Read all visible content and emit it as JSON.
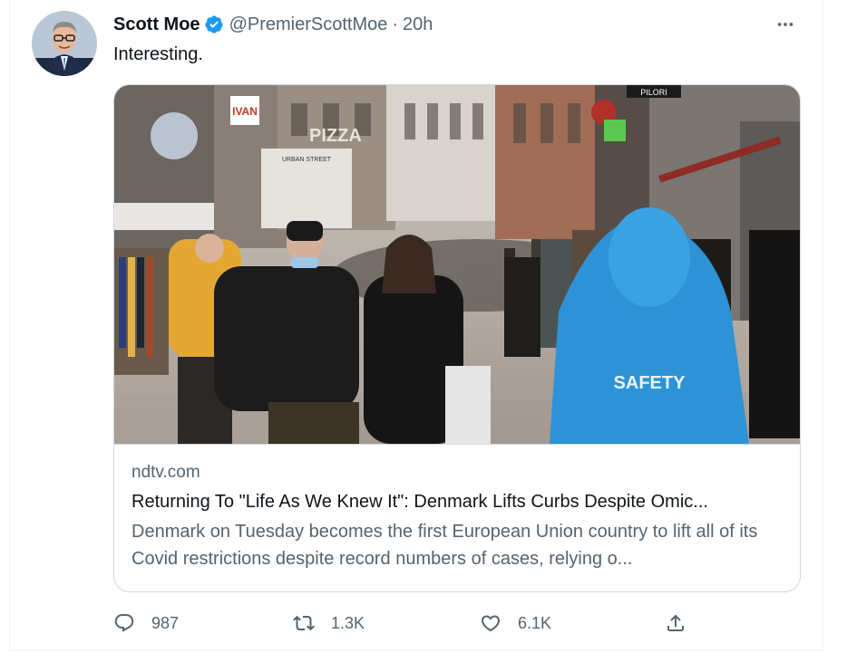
{
  "tweet": {
    "author_name": "Scott Moe",
    "handle": "@PremierScottMoe",
    "separator": "·",
    "time": "20h",
    "text": "Interesting.",
    "verified": true
  },
  "card": {
    "domain": "ndtv.com",
    "title": "Returning To \"Life As We Knew It\": Denmark Lifts Curbs Despite Omic...",
    "description": "Denmark on Tuesday becomes the first European Union country to lift all of its Covid restrictions despite record numbers of cases, relying o...",
    "image_signs": {
      "ivan": "IVAN",
      "pizza": "PIZZA",
      "sign": "URBAN STREET",
      "jacket": "SAFETY",
      "pilori": "PILORI"
    }
  },
  "actions": {
    "reply_count": "987",
    "retweet_count": "1.3K",
    "like_count": "6.1K"
  },
  "colors": {
    "verified_blue": "#1d9bf0",
    "secondary_text": "#536471",
    "primary_text": "#0f1419",
    "border": "#cfd9de"
  },
  "icons": {
    "more": "more-horizontal-icon",
    "reply": "reply-icon",
    "retweet": "retweet-icon",
    "like": "heart-icon",
    "share": "share-icon",
    "verified": "verified-badge-icon"
  }
}
